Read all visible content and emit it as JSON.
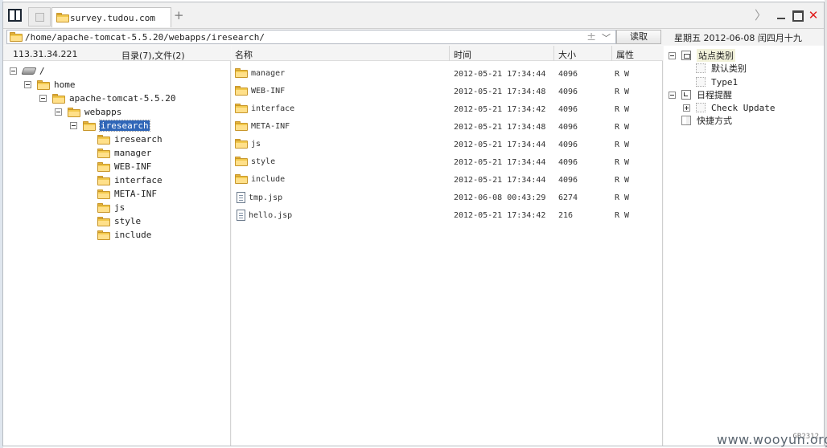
{
  "tab": {
    "title": "survey.tudou.com",
    "add": "+"
  },
  "window_controls": {
    "forward": "〉",
    "close": "✕"
  },
  "address": {
    "path": "/home/apache-tomcat-5.5.20/webapps/iresearch/",
    "plus": "±",
    "chevron": "﹀",
    "read_button": "读取"
  },
  "date": "星期五 2012-06-08 闰四月十九",
  "tree": {
    "ip": "113.31.34.221",
    "summary": "目录(7),文件(2)",
    "nodes": [
      {
        "label": "/",
        "icon": "drive-icon"
      },
      {
        "label": "home",
        "icon": "folder-icon"
      },
      {
        "label": "apache-tomcat-5.5.20",
        "icon": "folder-icon"
      },
      {
        "label": "webapps",
        "icon": "folder-icon"
      },
      {
        "label": "iresearch",
        "icon": "folder-open-icon",
        "selected": true
      },
      {
        "label": "iresearch",
        "icon": "folder-icon"
      },
      {
        "label": "manager",
        "icon": "folder-icon"
      },
      {
        "label": "WEB-INF",
        "icon": "folder-icon"
      },
      {
        "label": "interface",
        "icon": "folder-icon"
      },
      {
        "label": "META-INF",
        "icon": "folder-icon"
      },
      {
        "label": "js",
        "icon": "folder-icon"
      },
      {
        "label": "style",
        "icon": "folder-icon"
      },
      {
        "label": "include",
        "icon": "folder-icon"
      }
    ]
  },
  "list": {
    "columns": [
      "名称",
      "时间",
      "大小",
      "属性"
    ],
    "rows": [
      {
        "name": "manager",
        "time": "2012-05-21 17:34:44",
        "size": "4096",
        "attr": "R W",
        "type": "folder"
      },
      {
        "name": "WEB-INF",
        "time": "2012-05-21 17:34:48",
        "size": "4096",
        "attr": "R W",
        "type": "folder"
      },
      {
        "name": "interface",
        "time": "2012-05-21 17:34:42",
        "size": "4096",
        "attr": "R W",
        "type": "folder"
      },
      {
        "name": "META-INF",
        "time": "2012-05-21 17:34:48",
        "size": "4096",
        "attr": "R W",
        "type": "folder"
      },
      {
        "name": "js",
        "time": "2012-05-21 17:34:44",
        "size": "4096",
        "attr": "R W",
        "type": "folder"
      },
      {
        "name": "style",
        "time": "2012-05-21 17:34:44",
        "size": "4096",
        "attr": "R W",
        "type": "folder"
      },
      {
        "name": "include",
        "time": "2012-05-21 17:34:44",
        "size": "4096",
        "attr": "R W",
        "type": "folder"
      },
      {
        "name": "tmp.jsp",
        "time": "2012-06-08 00:43:29",
        "size": "6274",
        "attr": "R W",
        "type": "file"
      },
      {
        "name": "hello.jsp",
        "time": "2012-05-21 17:34:42",
        "size": "216",
        "attr": "R W",
        "type": "file"
      }
    ]
  },
  "sites": {
    "category_title": "站点类别",
    "categories": [
      "默认类别",
      "Type1"
    ],
    "reminder_title": "日程提醒",
    "reminders": [
      "Check Update"
    ],
    "shortcut_title": "快捷方式"
  },
  "corner_code": "GB2312",
  "watermark": "www.wooyun.org"
}
